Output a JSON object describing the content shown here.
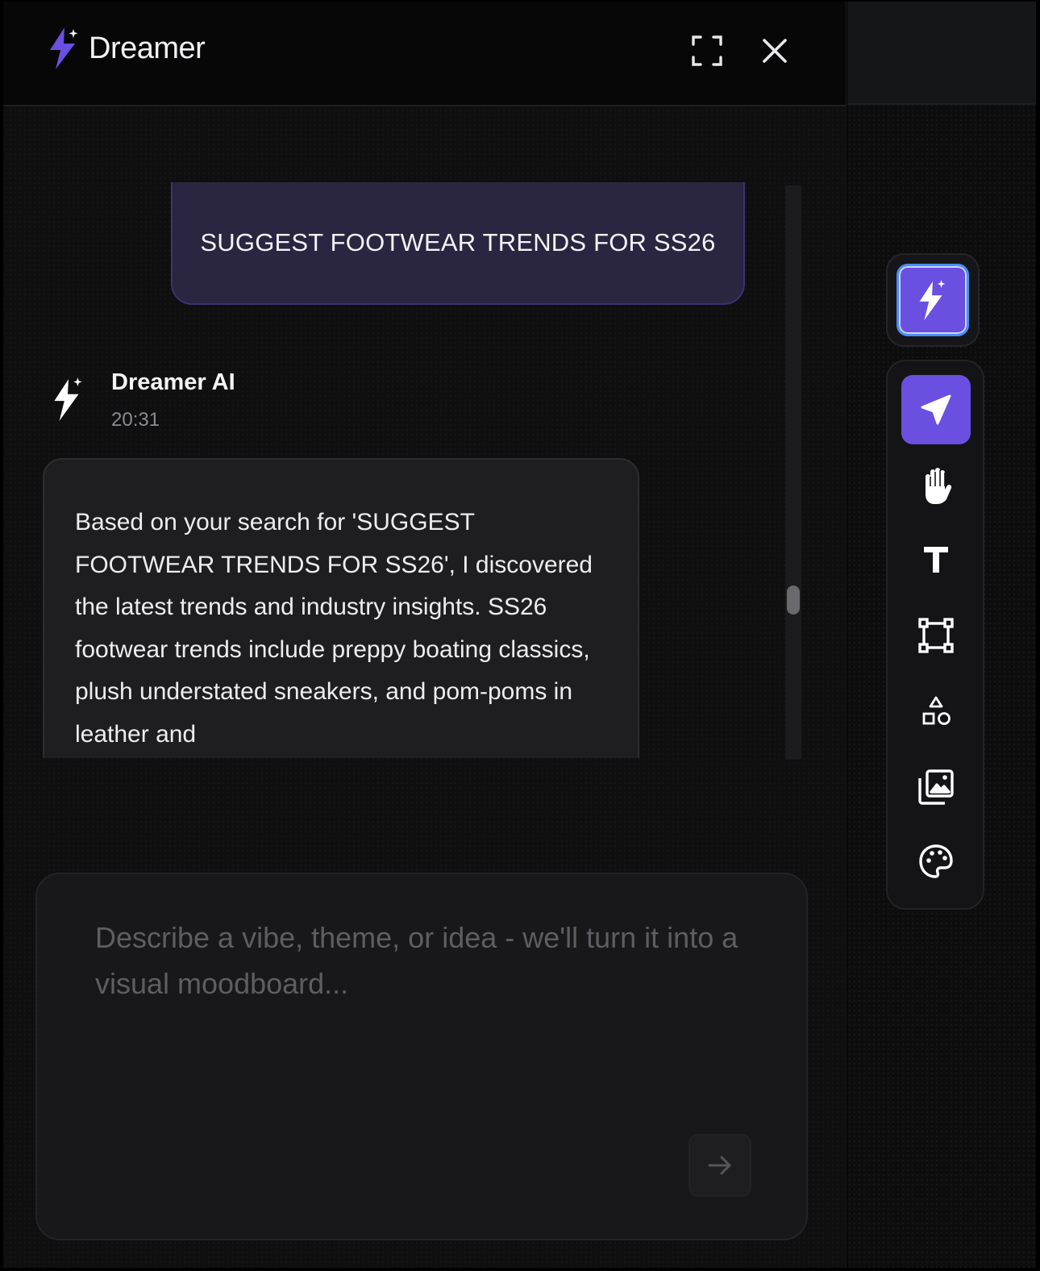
{
  "header": {
    "brand_name": "Dreamer",
    "brand_icon": "lightning-sparkle-icon",
    "expand_icon": "fullscreen-icon",
    "close_icon": "close-icon"
  },
  "conversation": {
    "user_message": "SUGGEST FOOTWEAR TRENDS FOR SS26",
    "assistant": {
      "name": "Dreamer AI",
      "time": "20:31",
      "message": "Based on your search for 'SUGGEST FOOTWEAR TRENDS FOR SS26', I discovered the latest trends and industry insights. SS26 footwear trends include preppy boating classics, plush understated sneakers, and pom-poms in leather and"
    }
  },
  "composer": {
    "placeholder": "Describe a vibe, theme, or idea - we'll turn it into a visual moodboard...",
    "value": "",
    "send_icon": "arrow-right-icon"
  },
  "toolbar": {
    "ai_tool_icon": "lightning-sparkle-icon",
    "tools": [
      {
        "icon": "select-pointer-icon",
        "active": true
      },
      {
        "icon": "hand-pan-icon",
        "active": false
      },
      {
        "icon": "text-icon",
        "active": false
      },
      {
        "icon": "frame-icon",
        "active": false
      },
      {
        "icon": "shapes-icon",
        "active": false
      },
      {
        "icon": "image-library-icon",
        "active": false
      },
      {
        "icon": "palette-icon",
        "active": false
      }
    ]
  },
  "colors": {
    "accent": "#6a4fe0",
    "user_bubble": "#2a2540",
    "panel_bg": "#0f0f10"
  }
}
